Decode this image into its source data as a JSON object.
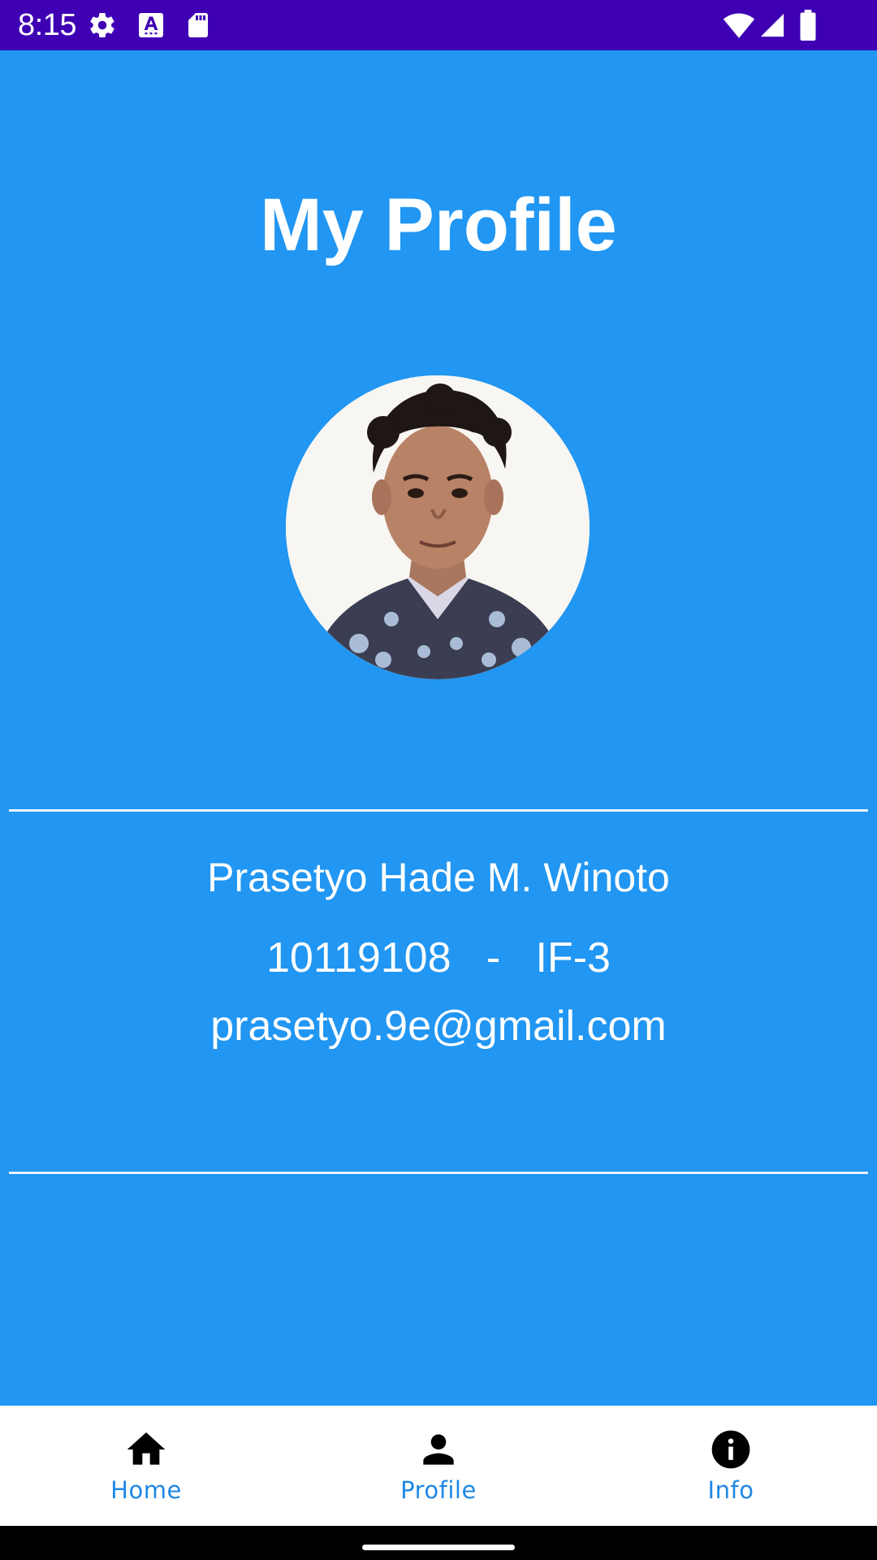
{
  "status_bar": {
    "time": "8:15",
    "icons": [
      "gear-icon",
      "font-icon",
      "sd-card-icon",
      "wifi-icon",
      "cellular-signal-icon",
      "battery-icon"
    ],
    "background": "#3F00B4"
  },
  "profile": {
    "title": "My Profile",
    "name": "Prasetyo Hade M. Winoto",
    "id_line": "10119108   -   IF-3",
    "email": "prasetyo.9e@gmail.com",
    "background": "#2196F2"
  },
  "bottom_nav": {
    "items": [
      {
        "label": "Home",
        "icon": "home-icon"
      },
      {
        "label": "Profile",
        "icon": "person-icon"
      },
      {
        "label": "Info",
        "icon": "info-icon"
      }
    ],
    "label_color": "#1E88E5"
  }
}
